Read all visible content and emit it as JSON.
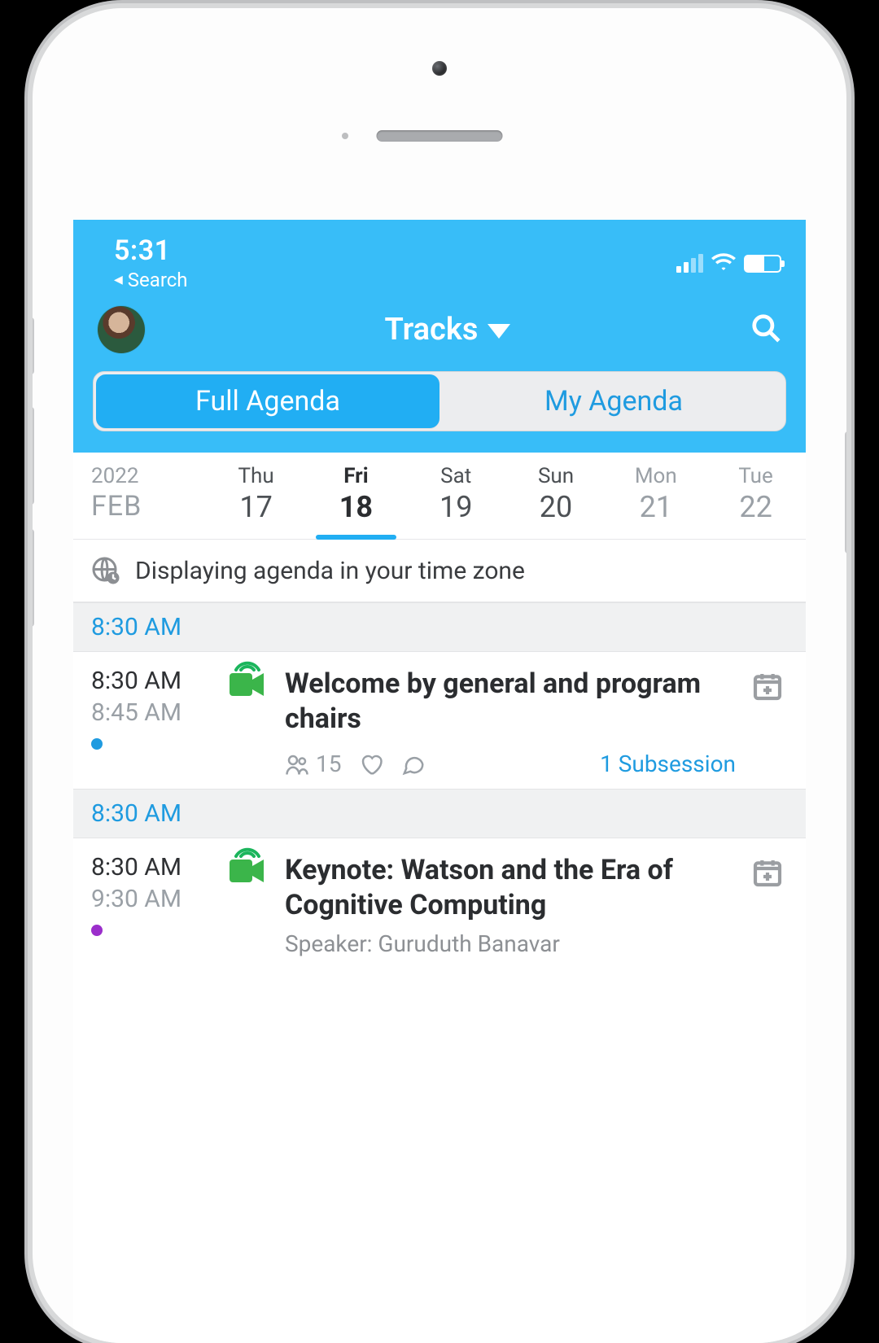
{
  "status": {
    "time": "5:31",
    "back_label": "Search"
  },
  "header": {
    "title": "Tracks"
  },
  "tabs": {
    "full": "Full Agenda",
    "my": "My Agenda"
  },
  "dates": {
    "year": "2022",
    "month": "FEB",
    "days": [
      {
        "dow": "Thu",
        "num": "17"
      },
      {
        "dow": "Fri",
        "num": "18",
        "selected": true
      },
      {
        "dow": "Sat",
        "num": "19"
      },
      {
        "dow": "Sun",
        "num": "20"
      },
      {
        "dow": "Mon",
        "num": "21"
      },
      {
        "dow": "Tue",
        "num": "22"
      }
    ]
  },
  "tz_banner": "Displaying agenda in your time zone",
  "sections": [
    {
      "time_header": "8:30 AM",
      "session": {
        "start": "8:30 AM",
        "end": "8:45 AM",
        "dot_color": "blue",
        "title": "Welcome by general and program chairs",
        "attendees": "15",
        "subsession": "1 Subsession"
      }
    },
    {
      "time_header": "8:30 AM",
      "session": {
        "start": "8:30 AM",
        "end": "9:30 AM",
        "dot_color": "purple",
        "title": "Keynote: Watson and the Era of Cognitive Computing",
        "speaker": "Speaker: Guruduth Banavar"
      }
    }
  ]
}
